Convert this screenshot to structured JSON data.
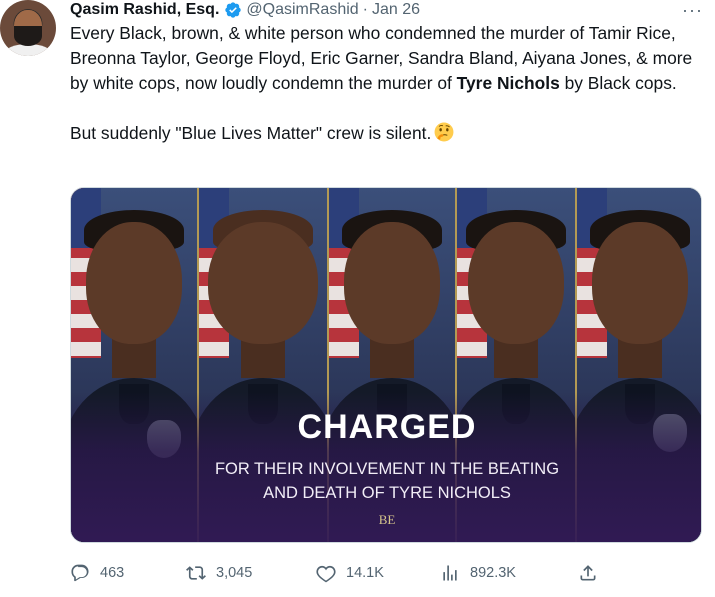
{
  "tweet": {
    "author_name": "Qasim Rashid, Esq.",
    "handle": "@QasimRashid",
    "separator": "·",
    "date": "Jan 26",
    "more_label": "···",
    "text_part1": "Every Black, brown, & white person who condemned the murder of Tamir Rice, Breonna Taylor, George Floyd, Eric Garner, Sandra Bland, Aiyana Jones, & more by white cops, now loudly condemn the murder of ",
    "text_bold": "Tyre Nichols",
    "text_part2": " by Black cops.",
    "text_line2": "But suddenly \"Blue Lives Matter\" crew is silent.",
    "emoji": "thinking-face"
  },
  "media": {
    "headline": "CHARGED",
    "subline1": "FOR THEIR INVOLVEMENT IN THE BEATING",
    "subline2": "AND DEATH OF TYRE NICHOLS",
    "brand_mark": "BE",
    "panel_count": 5
  },
  "actions": {
    "replies": "463",
    "retweets": "3,045",
    "likes": "14.1K",
    "views": "892.3K"
  },
  "colors": {
    "text_primary": "#0f1419",
    "text_secondary": "#536471",
    "verified_blue": "#1d9bf0",
    "overlay_purple": "#321a56"
  }
}
